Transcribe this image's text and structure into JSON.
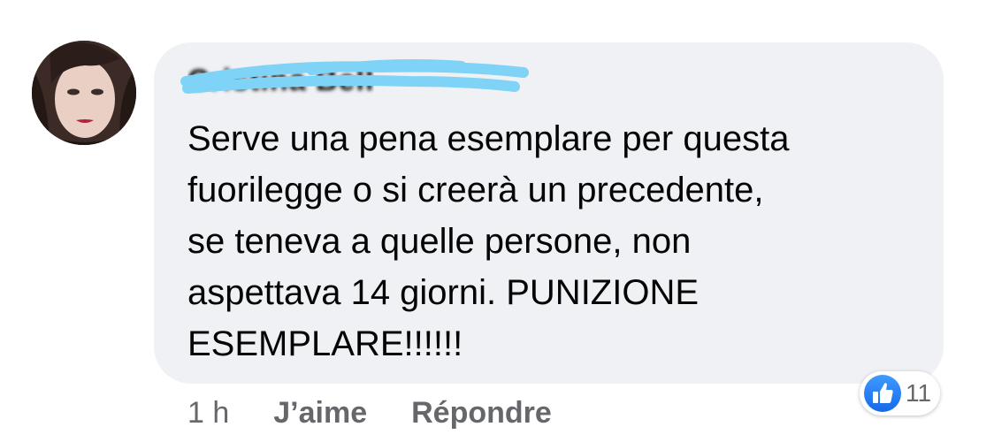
{
  "comment": {
    "author_name": "Cristina Bell",
    "text": "Serve una pena esemplare per questa\nfuorilegge o si creerà un precedente,\nse teneva a quelle persone, non\naspettava 14 giorni. PUNIZIONE\nESEMPLARE!!!!!!",
    "time": "1 h",
    "like_label": "J’aime",
    "reply_label": "Répondre",
    "reaction_count": "11"
  },
  "icons": {
    "avatar": "profile-photo",
    "reaction": "thumbs-up-icon"
  },
  "colors": {
    "bubble_bg": "#eff1f4",
    "text": "#050505",
    "secondary_text": "#65676b",
    "like_blue": "#1877f2",
    "redaction": "#7fd3f7"
  }
}
